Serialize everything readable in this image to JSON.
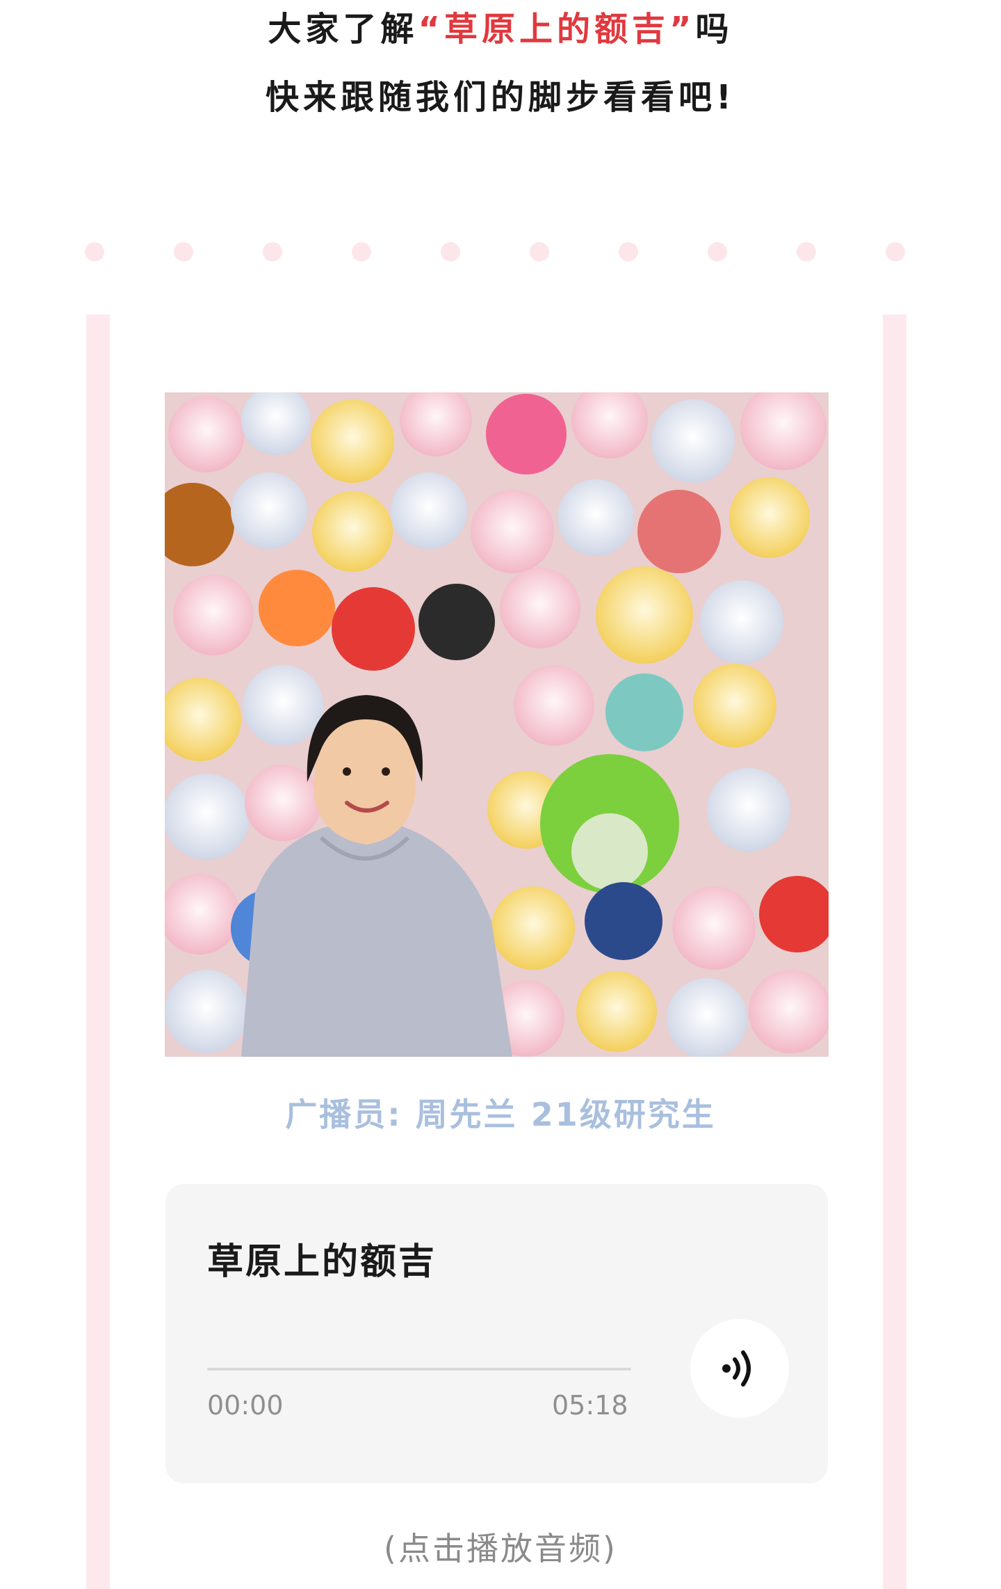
{
  "intro": {
    "line1_prefix": "大家了解",
    "line1_highlight": "“草原上的额吉”",
    "line1_suffix": "吗",
    "line2": "快来跟随我们的脚步看看吧!",
    "highlight_color": "#e0393e"
  },
  "photo": {
    "alt": "广播员周先兰在毛绒玩具墙前的照片"
  },
  "caption": "广播员: 周先兰   21级研究生",
  "audio": {
    "title": "草原上的额吉",
    "current_time": "00:00",
    "total_time": "05:18",
    "progress": 0,
    "play_icon": "audio-wave-icon"
  },
  "hint": "(点击播放音频)",
  "colors": {
    "accent_red": "#e0393e",
    "caption_blue": "#a9bfde",
    "decor_pink": "#fde6ea",
    "card_bg": "#f5f5f5"
  }
}
